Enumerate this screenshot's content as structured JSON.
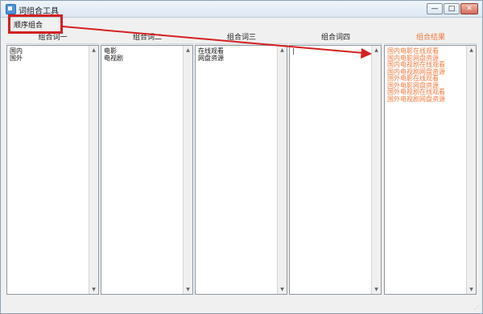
{
  "window": {
    "title": "词组合工具",
    "minimize_glyph": "—",
    "maximize_glyph": "□",
    "close_glyph": "✕"
  },
  "toolbar": {
    "button_label": "顺序组合"
  },
  "columns": [
    {
      "header": "组合词一",
      "content": "国内\n国外"
    },
    {
      "header": "组合词二",
      "content": "电影\n电视剧"
    },
    {
      "header": "组合词三",
      "content": "在线观看\n网盘资源"
    },
    {
      "header": "组合词四",
      "content": "|"
    },
    {
      "header": "组合结果",
      "content": "国内电影在线观看\n国内电影网盘资源\n国内电视剧在线观看\n国内电视剧网盘资源\n国外电影在线观看\n国外电影网盘资源\n国外电视剧在线观看\n国外电视剧网盘资源"
    }
  ],
  "scroll": {
    "up": "▲",
    "down": "▼"
  },
  "status": {
    "grip": "⋰"
  },
  "colors": {
    "annotation": "#d42020",
    "result_text": "#f07a3c",
    "title_gradient_top": "#eef4fb"
  }
}
